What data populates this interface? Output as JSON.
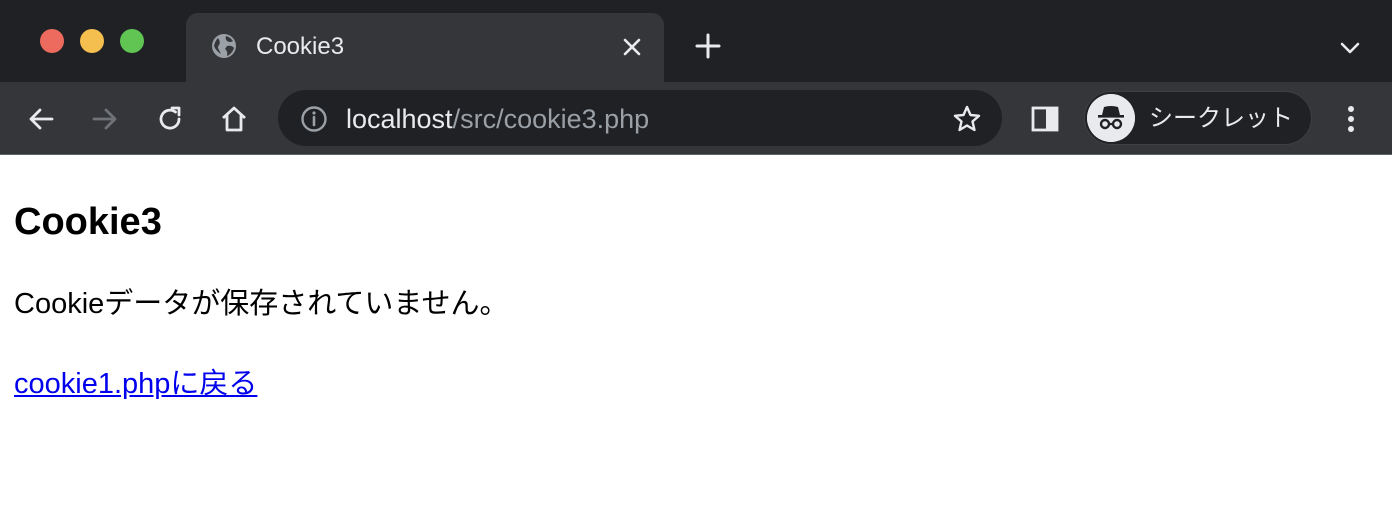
{
  "window": {
    "controls": {
      "close_color": "#ed6a5e",
      "minimize_color": "#f5bf4f",
      "maximize_color": "#61c554"
    }
  },
  "tab": {
    "title": "Cookie3",
    "favicon": "globe-icon"
  },
  "address_bar": {
    "host": "localhost",
    "path": "/src/cookie3.php"
  },
  "profile": {
    "label": "シークレット",
    "icon": "incognito-icon"
  },
  "page": {
    "heading": "Cookie3",
    "message": "Cookieデータが保存されていません。",
    "link_text": "cookie1.phpに戻る"
  },
  "colors": {
    "chrome_dark": "#202124",
    "chrome_toolbar": "#35363a",
    "link": "#0000ee"
  }
}
